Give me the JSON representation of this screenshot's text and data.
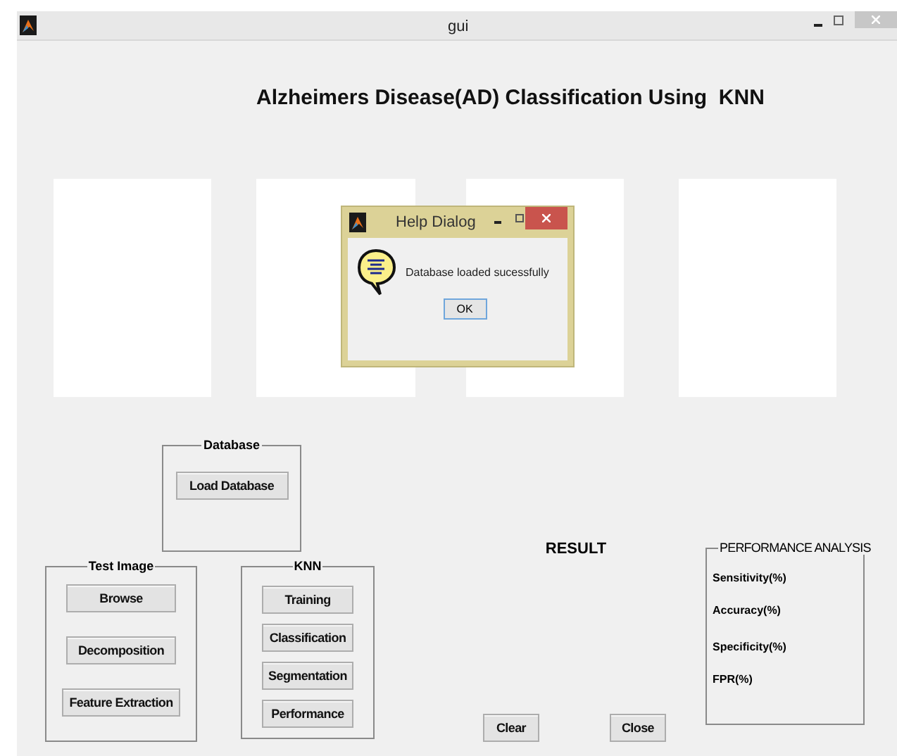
{
  "window": {
    "title": "gui"
  },
  "heading": "Alzheimers Disease(AD) Classification Using  KNN",
  "database_panel": {
    "title": "Database",
    "buttons": [
      "Load Database"
    ]
  },
  "test_image_panel": {
    "title": "Test Image",
    "buttons": [
      "Browse",
      "Decomposition",
      "Feature Extraction"
    ]
  },
  "knn_panel": {
    "title": "KNN",
    "buttons": [
      "Training",
      "Classification",
      "Segmentation",
      "Performance"
    ]
  },
  "result_label": "RESULT",
  "performance_panel": {
    "title": "PERFORMANCE ANALYSIS",
    "metrics": [
      "Sensitivity(%)",
      "Accuracy(%)",
      "Specificity(%)",
      "FPR(%)"
    ]
  },
  "actions": [
    "Clear",
    "Close"
  ],
  "dialog": {
    "title": "Help Dialog",
    "message": "Database loaded sucessfully",
    "button": "OK"
  }
}
